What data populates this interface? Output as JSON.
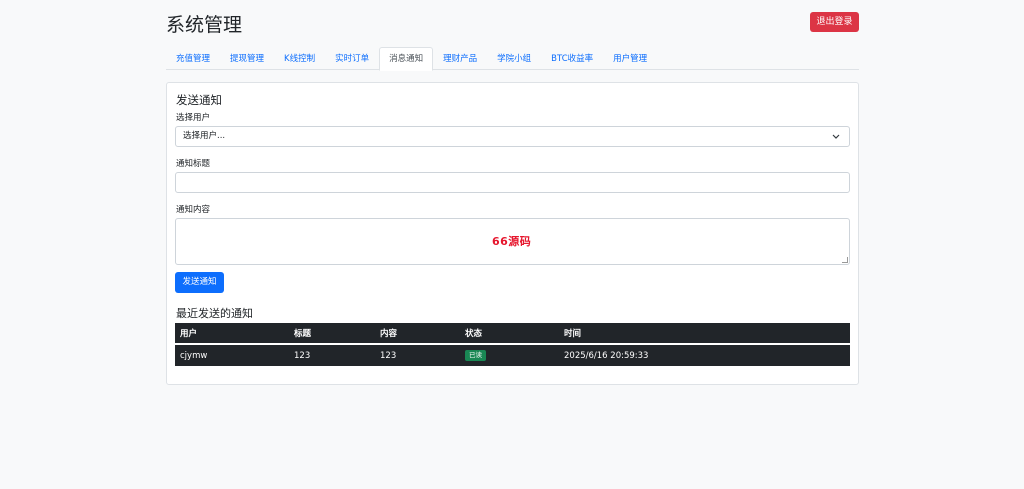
{
  "header": {
    "title": "系统管理",
    "logout_label": "退出登录"
  },
  "tabs": [
    {
      "label": "充值管理",
      "active": false
    },
    {
      "label": "提现管理",
      "active": false
    },
    {
      "label": "K线控制",
      "active": false
    },
    {
      "label": "实时订单",
      "active": false
    },
    {
      "label": "消息通知",
      "active": true
    },
    {
      "label": "理财产品",
      "active": false
    },
    {
      "label": "学院小组",
      "active": false
    },
    {
      "label": "BTC收益率",
      "active": false
    },
    {
      "label": "用户管理",
      "active": false
    }
  ],
  "form": {
    "section_title": "发送通知",
    "user_label": "选择用户",
    "user_selected": "选择用户...",
    "title_label": "通知标题",
    "title_value": "",
    "content_label": "通知内容",
    "content_value": "",
    "watermark": "66源码",
    "send_label": "发送通知"
  },
  "recent": {
    "title": "最近发送的通知",
    "columns": [
      "用户",
      "标题",
      "内容",
      "状态",
      "时间"
    ],
    "rows": [
      {
        "user": "cjymw",
        "title": "123",
        "content": "123",
        "status": "已读",
        "time": "2025/6/16 20:59:33"
      }
    ]
  },
  "colors": {
    "primary": "#0d6efd",
    "danger": "#dc3545",
    "success": "#198754",
    "table_dark": "#212529"
  }
}
